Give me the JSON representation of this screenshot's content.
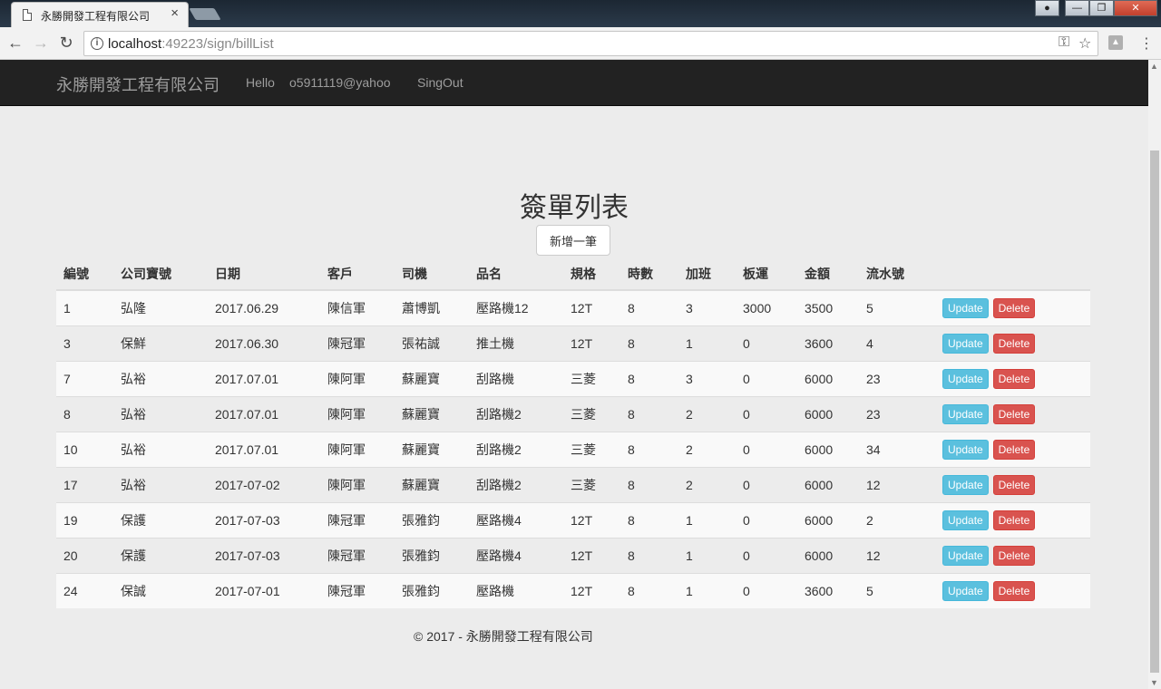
{
  "browser": {
    "tab_title": "永勝開發工程有限公司",
    "url_host": "localhost",
    "url_path": ":49223/sign/billList"
  },
  "navbar": {
    "brand": "永勝開發工程有限公司",
    "hello": "Hello",
    "user": "o5911119@yahoo",
    "signout": "SingOut"
  },
  "main": {
    "title": "簽單列表",
    "add_button": "新增一筆"
  },
  "table": {
    "headers": [
      "編號",
      "公司寶號",
      "日期",
      "客戶",
      "司機",
      "品名",
      "規格",
      "時數",
      "加班",
      "板運",
      "金額",
      "流水號"
    ],
    "update_label": "Update",
    "delete_label": "Delete",
    "rows": [
      [
        "1",
        "弘隆",
        "2017.06.29",
        "陳信軍",
        "蕭博凱",
        "壓路機12",
        "12T",
        "8",
        "3",
        "3000",
        "3500",
        "5"
      ],
      [
        "3",
        "保鮮",
        "2017.06.30",
        "陳冠軍",
        "張祐誠",
        "推土機",
        "12T",
        "8",
        "1",
        "0",
        "3600",
        "4"
      ],
      [
        "7",
        "弘裕",
        "2017.07.01",
        "陳阿軍",
        "蘇麗寶",
        "刮路機",
        "三菱",
        "8",
        "3",
        "0",
        "6000",
        "23"
      ],
      [
        "8",
        "弘裕",
        "2017.07.01",
        "陳阿軍",
        "蘇麗寶",
        "刮路機2",
        "三菱",
        "8",
        "2",
        "0",
        "6000",
        "23"
      ],
      [
        "10",
        "弘裕",
        "2017.07.01",
        "陳阿軍",
        "蘇麗寶",
        "刮路機2",
        "三菱",
        "8",
        "2",
        "0",
        "6000",
        "34"
      ],
      [
        "17",
        "弘裕",
        "2017-07-02",
        "陳阿軍",
        "蘇麗寶",
        "刮路機2",
        "三菱",
        "8",
        "2",
        "0",
        "6000",
        "12"
      ],
      [
        "19",
        "保護",
        "2017-07-03",
        "陳冠軍",
        "張雅鈞",
        "壓路機4",
        "12T",
        "8",
        "1",
        "0",
        "6000",
        "2"
      ],
      [
        "20",
        "保護",
        "2017-07-03",
        "陳冠軍",
        "張雅鈞",
        "壓路機4",
        "12T",
        "8",
        "1",
        "0",
        "6000",
        "12"
      ],
      [
        "24",
        "保誠",
        "2017-07-01",
        "陳冠軍",
        "張雅鈞",
        "壓路機",
        "12T",
        "8",
        "1",
        "0",
        "3600",
        "5"
      ]
    ]
  },
  "footer": {
    "text": "© 2017 - 永勝開發工程有限公司"
  }
}
